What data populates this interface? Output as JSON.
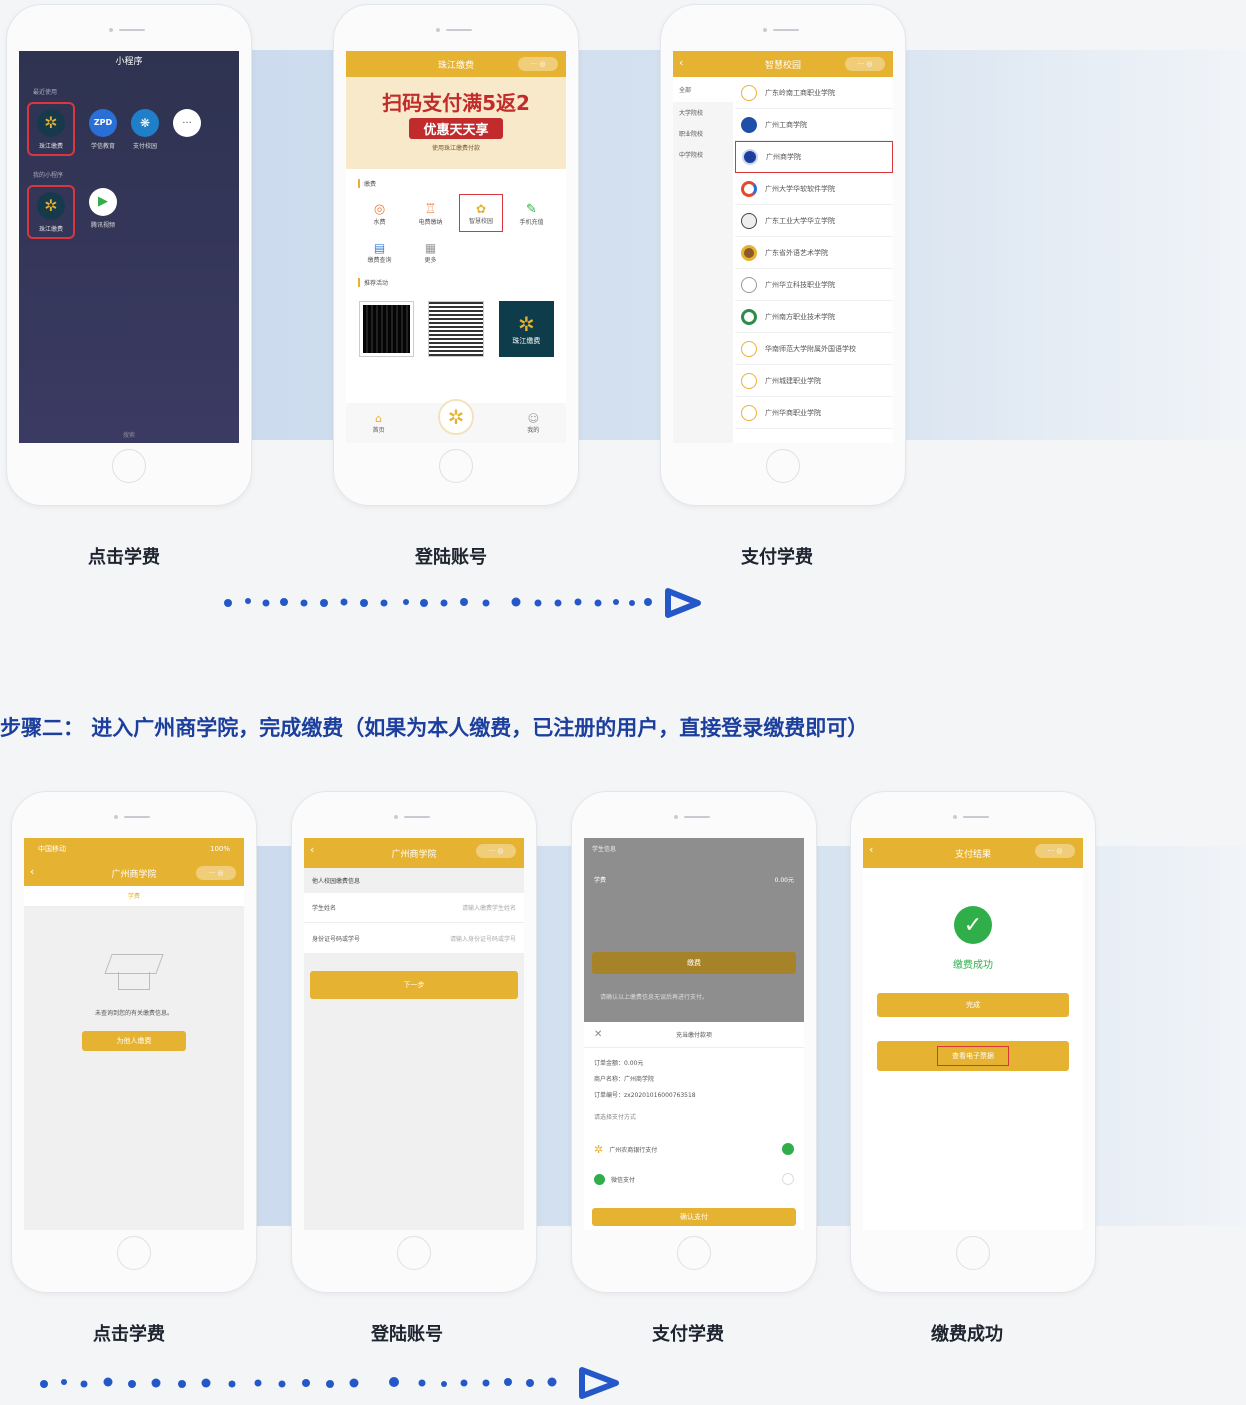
{
  "section1": {
    "captions": [
      "点击学费",
      "登陆账号",
      "支付学费"
    ],
    "phone1": {
      "title": "小程序",
      "group1_label": "最近使用",
      "group2_label": "我的小程序",
      "apps_row1": [
        "珠江缴费",
        "学信教育",
        "支付校园"
      ],
      "apps_row2": [
        "珠江缴费",
        "腾讯视频"
      ],
      "bottom": "搜索"
    },
    "phone2": {
      "title": "珠江缴费",
      "banner_main": "扫码支付满5返2",
      "banner_sub": "优惠天天享",
      "banner_small": "使用珠江缴费付款",
      "section1_label": "缴费",
      "services": [
        "水费",
        "电费缴纳",
        "智慧校园",
        "手机充值",
        "缴费查询",
        "更多"
      ],
      "section2_label": "推荐活动",
      "logo_text": "珠江缴费",
      "tabs": [
        "首页",
        "",
        "我的"
      ]
    },
    "phone3": {
      "title": "智慧校园",
      "categories": [
        "全部",
        "大学院校",
        "职业院校",
        "中学院校"
      ],
      "schools": [
        "广东岭南工商职业学院",
        "广州工商学院",
        "广州商学院",
        "广州大学华软软件学院",
        "广东工业大学华立学院",
        "广东省外语艺术学院",
        "广州华立科技职业学院",
        "广州南方职业技术学院",
        "华南师范大学附属外国语学校",
        "广州城建职业学院",
        "广州华商职业学院"
      ]
    }
  },
  "heading": "步骤二： 进入广州商学院，完成缴费（如果为本人缴费，已注册的用户，直接登录缴费即可）",
  "section2": {
    "captions": [
      "点击学费",
      "登陆账号",
      "支付学费",
      "缴费成功"
    ],
    "phone1": {
      "status_left": "中国移动",
      "status_right": "100%",
      "title": "广州商学院",
      "tab": "学费",
      "empty_text": "未查询到您的有关缴费信息。",
      "button": "为他人缴费"
    },
    "phone2": {
      "title": "广州商学院",
      "section_label": "他人校园缴费信息",
      "field1_label": "学生姓名",
      "field1_placeholder": "请输入缴费学生姓名",
      "field2_label": "身份证号码或学号",
      "field2_placeholder": "请输入身份证号码或学号",
      "button": "下一步"
    },
    "phone3": {
      "top_info": "学生信息",
      "fee_label": "学费",
      "fee_amount": "0.00元",
      "pay_button": "缴费",
      "note": "请确认以上缴费信息无误后再进行支付。",
      "dialog_title": "充当缴付款项",
      "amount_label": "订单金额：",
      "amount_value": "0.00元",
      "merchant_label": "商户名称：",
      "merchant_value": "广州商学院",
      "order_label": "订单编号：",
      "order_value": "zx20201016000763518",
      "method_label": "请选择支付方式",
      "method1": "广州农商银行支付",
      "method2": "微信支付",
      "confirm": "确认支付"
    },
    "phone4": {
      "title": "支付结果",
      "result": "缴费成功",
      "btn1": "完成",
      "btn2": "查看电子票据"
    }
  },
  "colors": {
    "heading": "#1c3f9e",
    "accent": "#e6b232",
    "dots": "#2458c8",
    "highlight": "#d9363e",
    "success": "#2fae4a"
  }
}
